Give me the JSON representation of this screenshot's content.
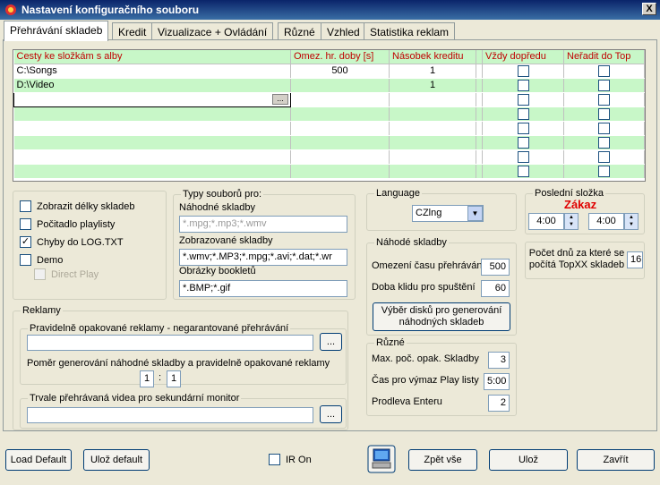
{
  "window": {
    "title": "Nastavení konfiguračního souboru",
    "close": "X"
  },
  "tabs": [
    {
      "label": "Přehrávání skladeb"
    },
    {
      "label": "Kredit"
    },
    {
      "label": "Vizualizace + Ovládání"
    },
    {
      "label": "Různé"
    },
    {
      "label": "Vzhled"
    },
    {
      "label": "Statistika reklam"
    }
  ],
  "grid": {
    "headers": [
      "Cesty ke složkám s alby",
      "Omez. hr. doby [s]",
      "Násobek kreditu",
      "",
      "Vždy dopředu",
      "Neřadit do Top"
    ],
    "rows": [
      {
        "path": "C:\\Songs",
        "limit": "500",
        "mult": "1"
      },
      {
        "path": "D:\\Video",
        "limit": "",
        "mult": "1"
      }
    ],
    "browse": "..."
  },
  "options": {
    "show_lengths": "Zobrazit délky skladeb",
    "playlist_counter": "Počitadlo playlisty",
    "errors_log": "Chyby do LOG.TXT",
    "demo": "Demo",
    "direct_play": "Direct Play"
  },
  "filetypes": {
    "title": "Typy souborů pro:",
    "random_label": "Náhodné skladby",
    "random_value": "*.mpg;*.mp3;*.wmv",
    "shown_label": "Zobrazované skladby",
    "shown_value": "*.wmv;*.MP3;*.mpg;*.avi;*.dat;*.wr",
    "booklet_label": "Obrázky bookletů",
    "booklet_value": "*.BMP;*.gif"
  },
  "language": {
    "title": "Language",
    "value": "CZlng"
  },
  "lastfolder": {
    "title": "Poslední složka",
    "warning": "Zákaz",
    "from": "4:00",
    "to": "4:00"
  },
  "days": {
    "label": "Počet dnů za které se počítá TopXX skladeb",
    "value": "16"
  },
  "random": {
    "title": "Náhodé skladby",
    "limit_label": "Omezení času přehrávání",
    "limit_value": "500",
    "idle_label": "Doba klidu pro spuštění",
    "idle_value": "60",
    "disk_button": "Výběr disků pro generování náhodných skladeb"
  },
  "misc": {
    "title": "Různé",
    "max_label": "Max. poč. opak. Skladby",
    "max_value": "3",
    "time_label": "Čas pro výmaz  Play listy",
    "time_value": "5:00",
    "enter_label": "Prodleva Enteru",
    "enter_value": "2"
  },
  "ads": {
    "title": "Reklamy",
    "repeat_title": "Pravidelně opakované reklamy - negarantované přehrávání",
    "ratio_label": "Poměr generování náhodné skladby a pravidelně opakované reklamy",
    "ratio_a": "1",
    "ratio_sep": ":",
    "ratio_b": "1",
    "monitor_title": "Trvale přehrávaná videa pro sekundární monitor",
    "browse": "..."
  },
  "footer": {
    "load_default": "Load Default",
    "save_default": "Ulož default",
    "ir_on": "IR On",
    "back_all": "Zpět vše",
    "save": "Ulož",
    "close": "Zavřít"
  }
}
